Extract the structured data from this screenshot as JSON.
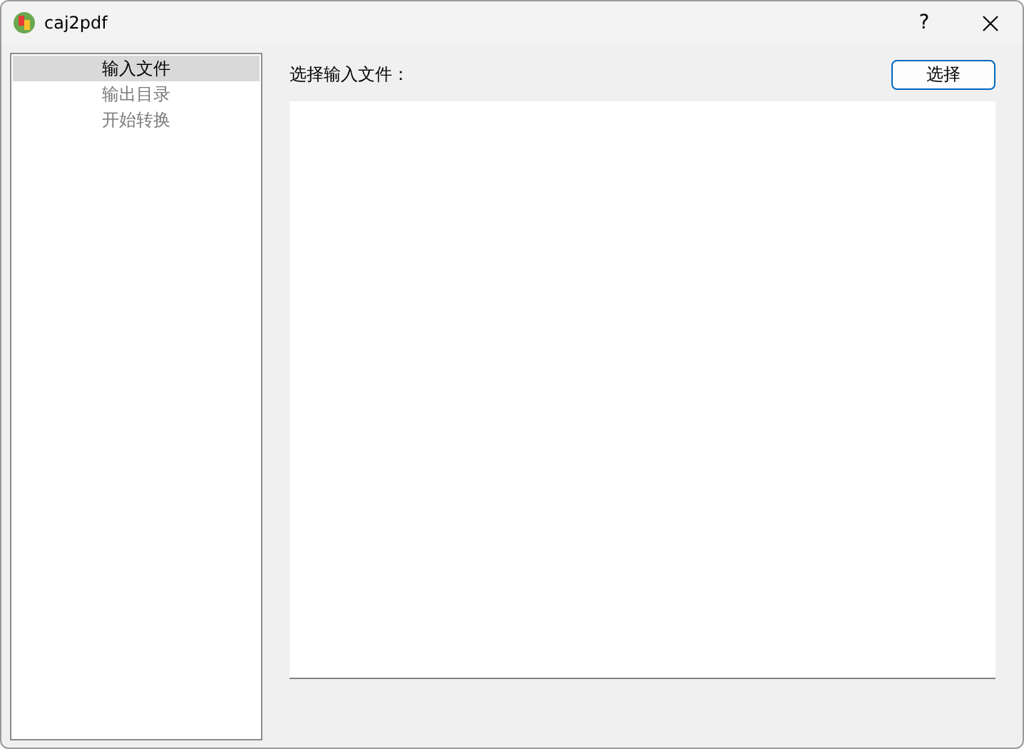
{
  "window": {
    "title": "caj2pdf",
    "help_button": "?"
  },
  "sidebar": {
    "items": [
      {
        "label": "输入文件",
        "selected": true
      },
      {
        "label": "输出目录",
        "selected": false
      },
      {
        "label": "开始转换",
        "selected": false
      }
    ]
  },
  "main": {
    "label": "选择输入文件：",
    "choose_button": "选择"
  }
}
